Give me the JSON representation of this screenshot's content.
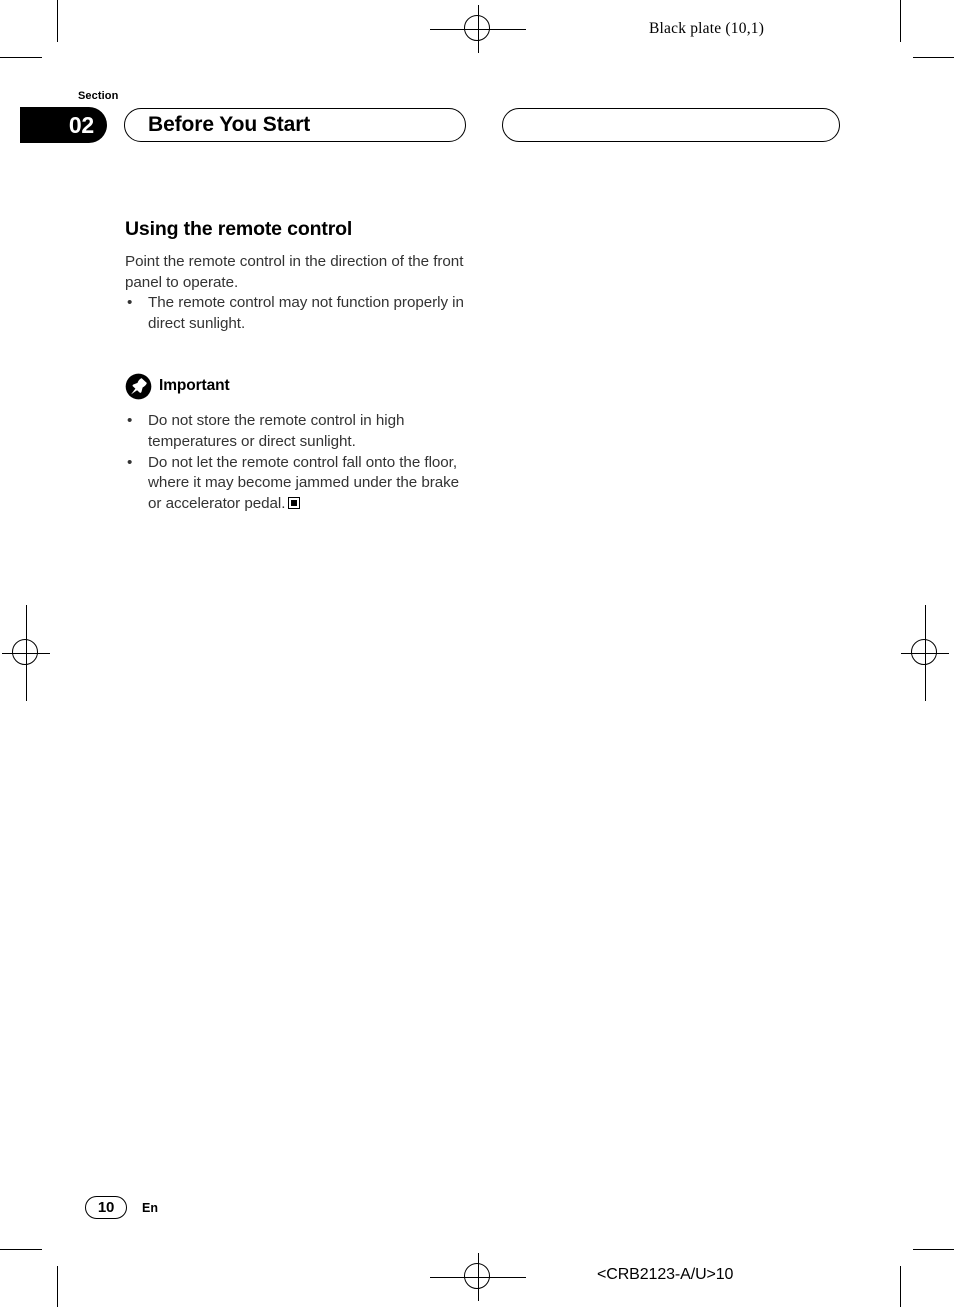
{
  "document": {
    "running_head": "Black plate (10,1)",
    "doc_code": "<CRB2123-A/U>10"
  },
  "header": {
    "section_label": "Section",
    "section_number": "02",
    "section_title": "Before You Start",
    "blank_pill": ""
  },
  "content": {
    "heading": "Using the remote control",
    "intro": "Point the remote control in the direction of the front panel to operate.",
    "intro_bullets": [
      {
        "marker": "•",
        "text": "The remote control may not function properly in direct sunlight."
      }
    ],
    "important": {
      "icon": "pin-icon",
      "label": "Important",
      "bullets": [
        {
          "marker": "•",
          "text": "Do not store the remote control in high temperatures or direct sunlight."
        },
        {
          "marker": "•",
          "text": "Do not let the remote control fall onto the floor, where it may become jammed under the brake or accelerator pedal."
        }
      ],
      "end_marker": "end-of-topic-marker"
    }
  },
  "footer": {
    "page_number": "10",
    "language_code": "En"
  },
  "colors": {
    "ink": "#000000",
    "body_text": "#333333",
    "paper": "#ffffff"
  }
}
